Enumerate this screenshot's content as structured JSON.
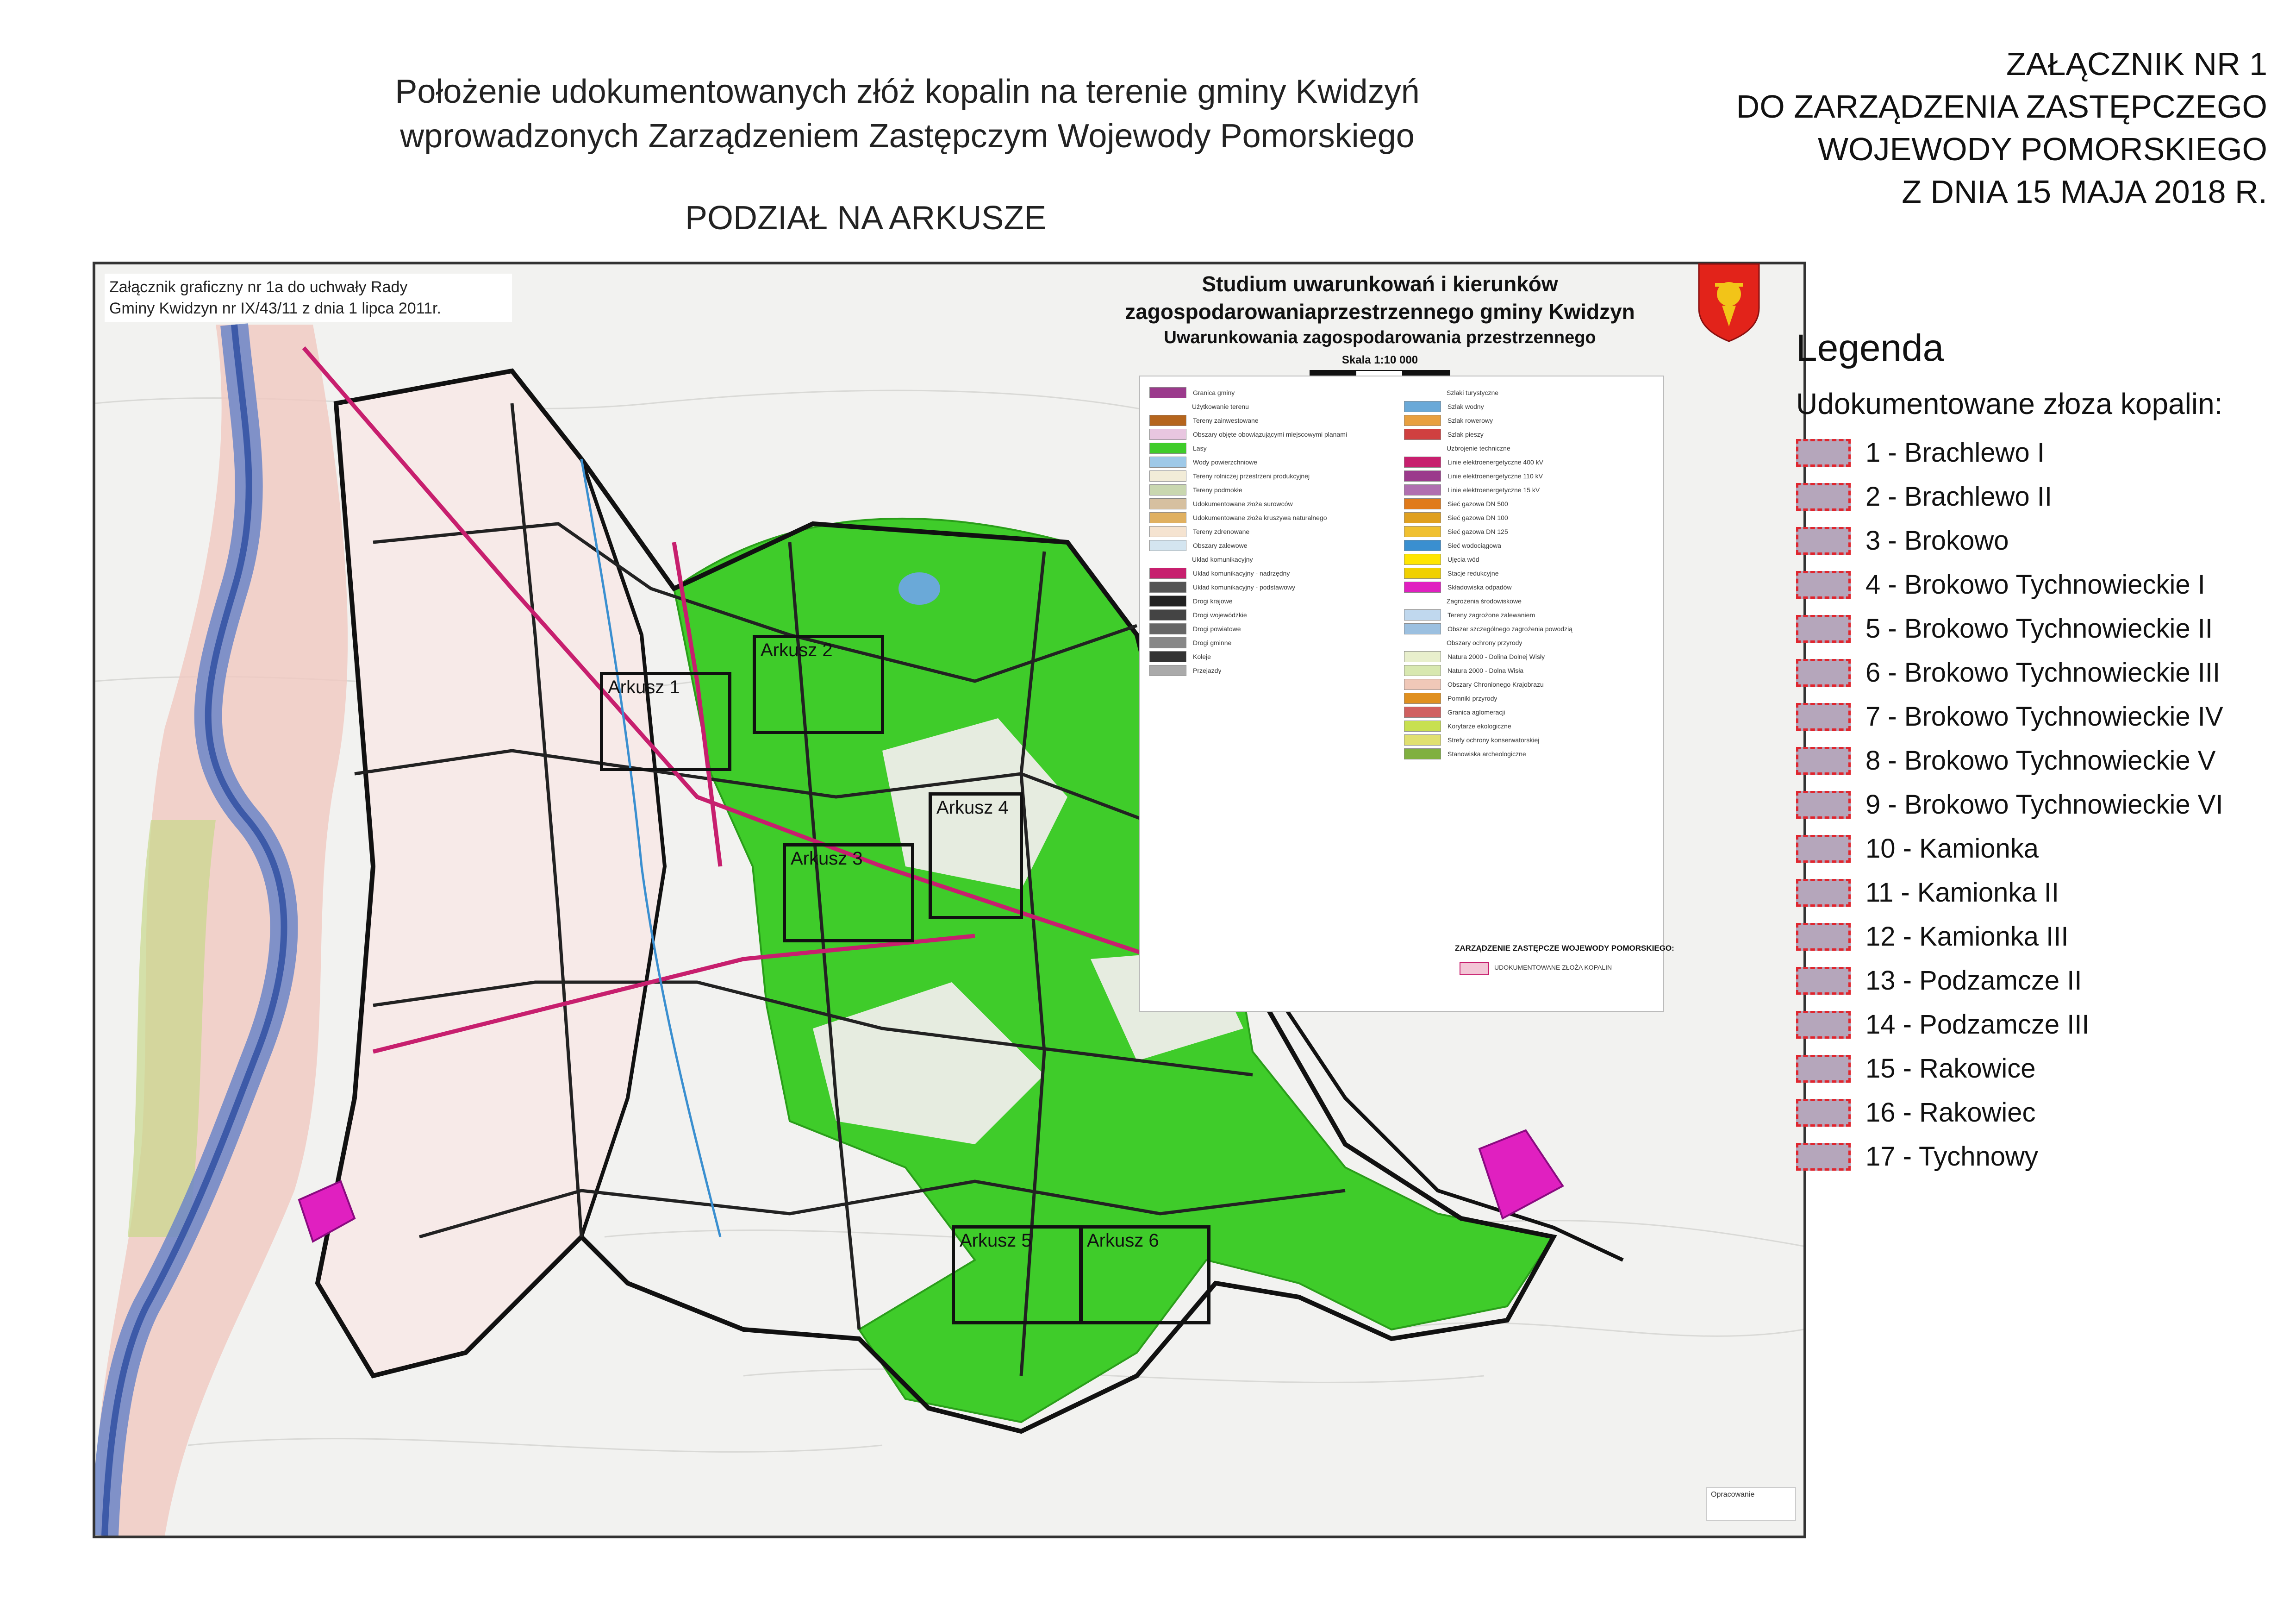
{
  "header": {
    "title_line1": "Położenie udokumentowanych złóż kopalin na terenie gminy Kwidzyń",
    "title_line2": "wprowadzonych Zarządzeniem Zastępczym Wojewody Pomorskiego",
    "subtitle": "PODZIAŁ NA ARKUSZE",
    "annex": [
      "ZAŁĄCZNIK NR 1",
      "DO ZARZĄDZENIA ZASTĘPCZEGO",
      "WOJEWODY POMORSKIEGO",
      "Z DNIA 15 MAJA 2018 R."
    ]
  },
  "map": {
    "attachment_note_line1": "Załącznik graficzny nr 1a do uchwały Rady",
    "attachment_note_line2": "Gminy Kwidzyn nr IX/43/11 z dnia 1 lipca 2011r.",
    "study_title_line1": "Studium uwarunkowań i kierunków",
    "study_title_line2": "zagospodarowaniaprzestrzennego gminy Kwidzyn",
    "study_title_line3": "Uwarunkowania zagospodarowania przestrzennego",
    "scale": "Skala 1:10 000",
    "order_text": "ZARZĄDZENIE ZASTĘPCZE WOJEWODY POMORSKIEGO:",
    "order_legend_label": "UDOKUMENTOWANE ZŁOŻA KOPALIN",
    "map_legend_left": [
      {
        "label": "Granica gminy",
        "color": "#9b3a8c"
      },
      {
        "label": "Użytkowanie terenu",
        "color": "#ffffff"
      },
      {
        "label": "Tereny zainwestowane",
        "color": "#b5651d"
      },
      {
        "label": "Obszary objęte obowiązującymi miejscowymi planami",
        "color": "#e8c6e0"
      },
      {
        "label": "Lasy",
        "color": "#3fcc2a"
      },
      {
        "label": "Wody powierzchniowe",
        "color": "#9ec9e8"
      },
      {
        "label": "Tereny rolniczej przestrzeni produkcyjnej",
        "color": "#f2ecd8"
      },
      {
        "label": "Tereny podmokłe",
        "color": "#c9d7b0"
      },
      {
        "label": "Udokumentowane złoża surowców",
        "color": "#d6c0a0"
      },
      {
        "label": "Udokumentowane złoża kruszywa naturalnego",
        "color": "#e0b060"
      },
      {
        "label": "Tereny zdrenowane",
        "color": "#f5e3d0"
      },
      {
        "label": "Obszary zalewowe",
        "color": "#d4e5f0"
      },
      {
        "label": "Układ komunikacyjny",
        "color": "#ffffff"
      },
      {
        "label": "Układ komunikacyjny - nadrzędny",
        "color": "#c71f6e"
      },
      {
        "label": "Układ komunikacyjny - podstawowy",
        "color": "#555555"
      },
      {
        "label": "Drogi krajowe",
        "color": "#222222"
      },
      {
        "label": "Drogi wojewódzkie",
        "color": "#444444"
      },
      {
        "label": "Drogi powiatowe",
        "color": "#666666"
      },
      {
        "label": "Drogi gminne",
        "color": "#888888"
      },
      {
        "label": "Koleje",
        "color": "#333333"
      },
      {
        "label": "Przejazdy",
        "color": "#aaaaaa"
      }
    ],
    "map_legend_right": [
      {
        "label": "Szlaki turystyczne",
        "color": "#ffffff"
      },
      {
        "label": "Szlak wodny",
        "color": "#6aa9d8"
      },
      {
        "label": "Szlak rowerowy",
        "color": "#e8a040"
      },
      {
        "label": "Szlak pieszy",
        "color": "#d04040"
      },
      {
        "label": "Uzbrojenie techniczne",
        "color": "#ffffff"
      },
      {
        "label": "Linie elektroenergetyczne 400 kV",
        "color": "#c71f6e"
      },
      {
        "label": "Linie elektroenergetyczne 110 kV",
        "color": "#9b3a8c"
      },
      {
        "label": "Linie elektroenergetyczne 15 kV",
        "color": "#b06fb0"
      },
      {
        "label": "Sieć gazowa DN 500",
        "color": "#e07a1a"
      },
      {
        "label": "Sieć gazowa DN 100",
        "color": "#e0a020"
      },
      {
        "label": "Sieć gazowa DN 125",
        "color": "#f0c030"
      },
      {
        "label": "Sieć wodociągowa",
        "color": "#3a8fd0"
      },
      {
        "label": "Ujęcia wód",
        "color": "#ffe600"
      },
      {
        "label": "Stacje redukcyjne",
        "color": "#f0d000"
      },
      {
        "label": "Składowiska odpadów",
        "color": "#e020c0"
      },
      {
        "label": "Zagrożenia środowiskowe",
        "color": "#ffffff"
      },
      {
        "label": "Tereny zagrożone zalewaniem",
        "color": "#c0d8ee"
      },
      {
        "label": "Obszar szczególnego zagrożenia powodzią",
        "color": "#9cc0e0"
      },
      {
        "label": "Obszary ochrony przyrody",
        "color": "#ffffff"
      },
      {
        "label": "Natura 2000 - Dolina Dolnej Wisły",
        "color": "#e8efcc"
      },
      {
        "label": "Natura 2000 - Dolna Wisła",
        "color": "#d8e8b0"
      },
      {
        "label": "Obszary Chronionego Krajobrazu",
        "color": "#f0c8b8"
      },
      {
        "label": "Pomniki przyrody",
        "color": "#e09020"
      },
      {
        "label": "Granica aglomeracji",
        "color": "#d06060"
      },
      {
        "label": "Korytarze ekologiczne",
        "color": "#c8e050"
      },
      {
        "label": "Strefy ochrony konserwatorskiej",
        "color": "#e0e070"
      },
      {
        "label": "Stanowiska archeologiczne",
        "color": "#80b040"
      }
    ]
  },
  "sheets": [
    {
      "label": "Arkusz 1"
    },
    {
      "label": "Arkusz 2"
    },
    {
      "label": "Arkusz 3"
    },
    {
      "label": "Arkusz 4"
    },
    {
      "label": "Arkusz 5"
    },
    {
      "label": "Arkusz 6"
    }
  ],
  "author_note": "Opracowanie",
  "legend": {
    "title": "Legenda",
    "subtitle": "Udokumentowane złoza kopalin:",
    "swatch_color": "#b5a6bb",
    "swatch_border": "#e0262e",
    "items": [
      "1 - Brachlewo I",
      "2 - Brachlewo II",
      "3 - Brokowo",
      "4 - Brokowo Tychnowieckie I",
      "5 - Brokowo Tychnowieckie II",
      "6 - Brokowo Tychnowieckie III",
      "7 - Brokowo Tychnowieckie IV",
      "8 - Brokowo Tychnowieckie V",
      "9 - Brokowo Tychnowieckie VI",
      "10 - Kamionka",
      "11 - Kamionka II",
      "12 - Kamionka III",
      "13 - Podzamcze II",
      "14 - Podzamcze III",
      "15 - Rakowice",
      "16 - Rakowiec",
      "17 - Tychnowy"
    ]
  },
  "colors": {
    "forest": "#3fcc2a",
    "river": "#6c86c8",
    "boundary": "#111111",
    "deposit": "#e020c0"
  }
}
